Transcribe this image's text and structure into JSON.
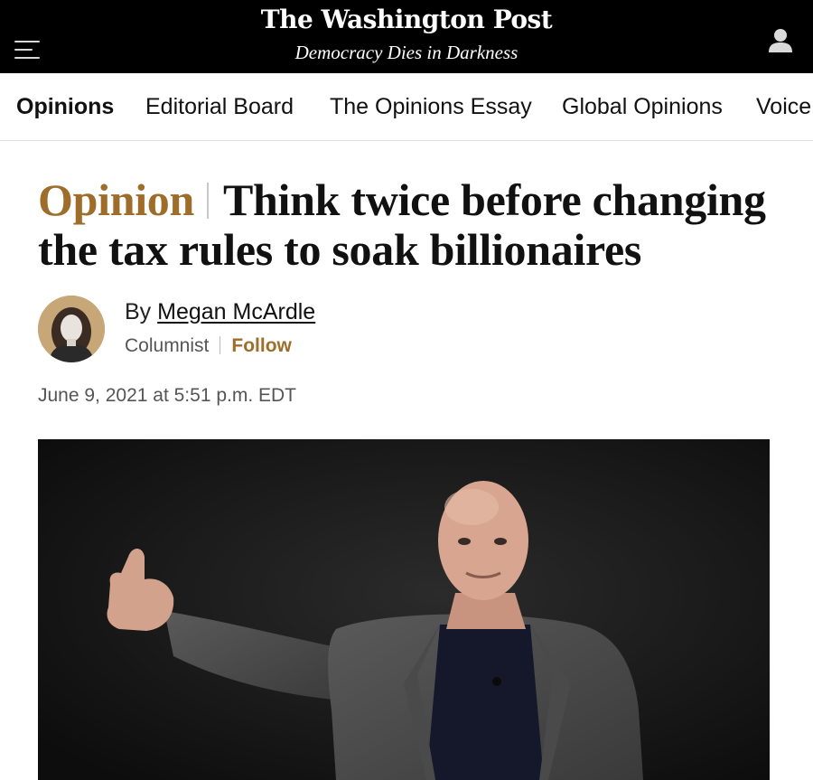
{
  "masthead": {
    "logo": "The Washington Post",
    "tagline": "Democracy Dies in Darkness"
  },
  "icons": {
    "menu": "hamburger-menu-icon",
    "user": "user-account-icon"
  },
  "nav": {
    "items": [
      {
        "label": "Opinions",
        "active": true
      },
      {
        "label": "Editorial Board",
        "active": false
      },
      {
        "label": "The Opinions Essay",
        "active": false
      },
      {
        "label": "Global Opinions",
        "active": false
      },
      {
        "label": "Voice",
        "active": false
      }
    ]
  },
  "article": {
    "kicker": "Opinion",
    "title": "Think twice before changing the tax rules to soak billionaires",
    "byline_prefix": "By",
    "author": "Megan McArdle",
    "role": "Columnist",
    "follow_label": "Follow",
    "timestamp": "June 9, 2021 at 5:51 p.m. EDT"
  },
  "colors": {
    "masthead_bg": "#000000",
    "accent": "#9e6d2a",
    "photo_bg": "#161616"
  }
}
